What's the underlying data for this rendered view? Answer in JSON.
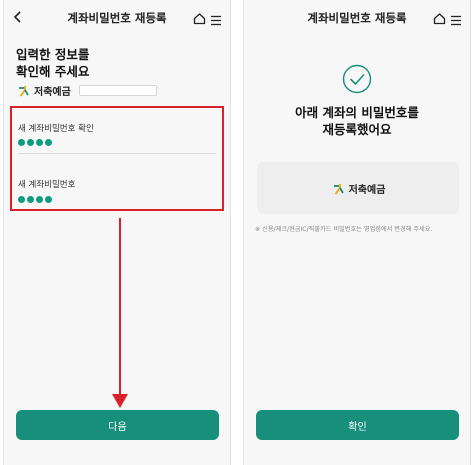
{
  "colors": {
    "brand": "#178f7a",
    "highlight": "#d8212a",
    "pin_dot": "#0f9a82"
  },
  "left_screen": {
    "header": {
      "title": "계좌비밀번호 재등록",
      "back_icon": "chevron-left-icon",
      "home_icon": "home-icon",
      "menu_icon": "hamburger-menu-icon"
    },
    "heading_line1": "입력한 정보를",
    "heading_line2": "확인해 주세요",
    "bank": {
      "logo_icon": "bank-logo-icon",
      "name": "저축예금"
    },
    "fields": [
      {
        "label": "새 계좌비밀번호 확인",
        "masked_digits": 4
      },
      {
        "label": "새 계좌비밀번호",
        "masked_digits": 4
      }
    ],
    "next_button": "다음"
  },
  "right_screen": {
    "header": {
      "title": "계좌비밀번호 재등록",
      "home_icon": "home-icon",
      "menu_icon": "hamburger-menu-icon"
    },
    "success_icon": "check-circle-icon",
    "message_line1": "아래 계좌의 비밀번호를",
    "message_line2": "재등록했어요",
    "account_bank_name": "저축예금",
    "notice": "※ 신용/체크/현금IC/직불카드 비밀번호는 영업점에서 변경해 주세요.",
    "confirm_button": "확인"
  }
}
